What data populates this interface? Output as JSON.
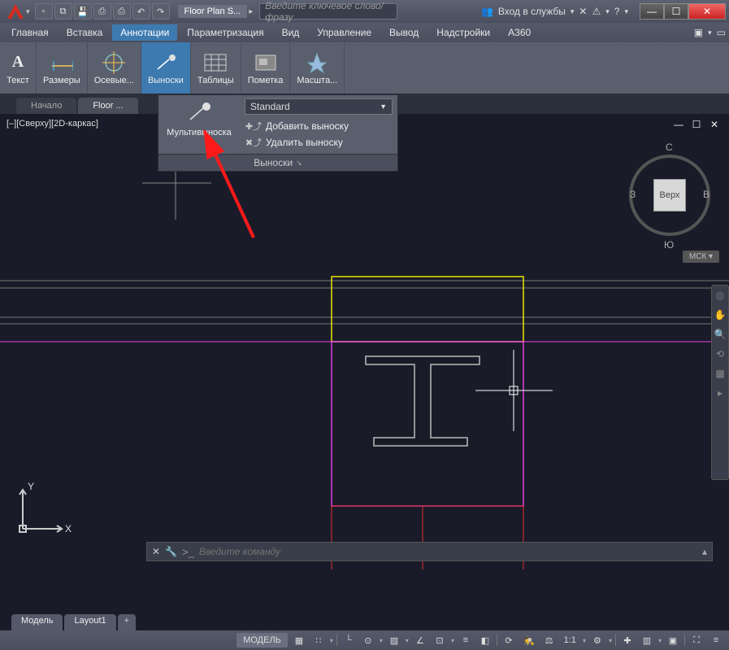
{
  "titlebar": {
    "title": "Floor Plan S...",
    "search_placeholder": "Введите ключевое слово/фразу",
    "login": "Вход в службы"
  },
  "menu": {
    "items": [
      "Главная",
      "Вставка",
      "Аннотации",
      "Параметризация",
      "Вид",
      "Управление",
      "Вывод",
      "Надстройки",
      "A360"
    ],
    "active_index": 2
  },
  "ribbon": {
    "panels": [
      {
        "label": "Текст",
        "icon": "A"
      },
      {
        "label": "Размеры",
        "icon": "↔"
      },
      {
        "label": "Осевые...",
        "icon": "⊕"
      },
      {
        "label": "Выноски",
        "icon": "⤴"
      },
      {
        "label": "Таблицы",
        "icon": "▦"
      },
      {
        "label": "Пометка",
        "icon": "◫"
      },
      {
        "label": "Масшта...",
        "icon": "✦"
      }
    ],
    "selected_index": 3
  },
  "file_tabs": {
    "tabs": [
      "Начало",
      "Floor ..."
    ],
    "active_index": 1
  },
  "viewport": {
    "label": "[–][Сверху][2D-каркас]"
  },
  "viewcube": {
    "face": "Верх",
    "n": "С",
    "s": "Ю",
    "e": "В",
    "w": "З",
    "wcs": "МСК ▾"
  },
  "dropdown": {
    "main_label": "Мультивыноска",
    "style": "Standard",
    "add_label": "Добавить выноску",
    "remove_label": "Удалить выноску",
    "footer": "Выноски"
  },
  "cmdline": {
    "placeholder": "Введите команду",
    "prefix": ">_"
  },
  "layout_tabs": {
    "tabs": [
      "Модель",
      "Layout1"
    ],
    "plus": "+"
  },
  "statusbar": {
    "model": "МОДЕЛЬ",
    "scale": "1:1"
  },
  "ucs": {
    "x": "X",
    "y": "Y"
  }
}
